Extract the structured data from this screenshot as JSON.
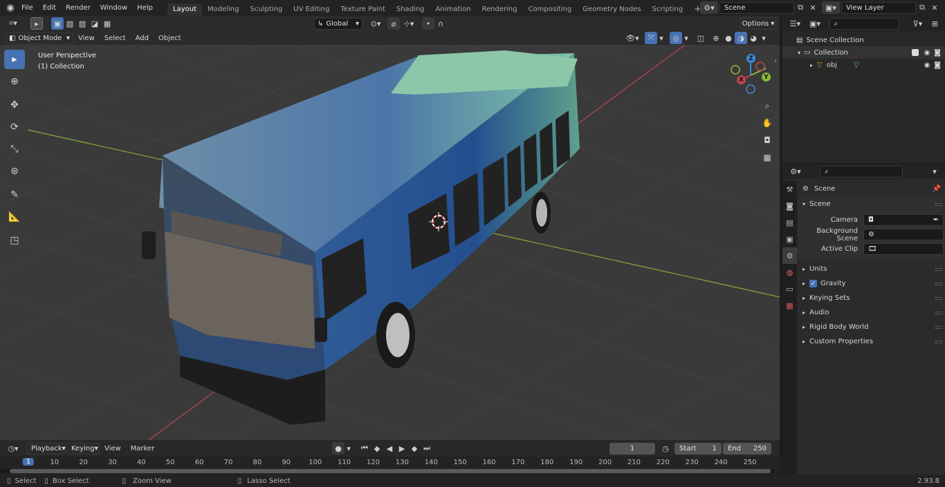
{
  "topbar": {
    "menus": [
      "File",
      "Edit",
      "Render",
      "Window",
      "Help"
    ],
    "workspaces": [
      "Layout",
      "Modeling",
      "Sculpting",
      "UV Editing",
      "Texture Paint",
      "Shading",
      "Animation",
      "Rendering",
      "Compositing",
      "Geometry Nodes",
      "Scripting"
    ],
    "add_tab": "+",
    "scene_value": "Scene",
    "view_layer_value": "View Layer"
  },
  "viewport_header": {
    "transform_orientation": "Global",
    "options_label": "Options",
    "mode": "Object Mode",
    "menus": [
      "View",
      "Select",
      "Add",
      "Object"
    ]
  },
  "viewport": {
    "overlay_line1": "User Perspective",
    "overlay_line2": "(1) Collection",
    "gizmo": {
      "z": "Z",
      "y": "Y",
      "x": "X"
    }
  },
  "outliner": {
    "scene_collection": "Scene Collection",
    "collection": "Collection",
    "object": "obj"
  },
  "properties": {
    "context_label": "Scene",
    "panel_title": "Scene",
    "fields": [
      {
        "label": "Camera",
        "value": ""
      },
      {
        "label": "Background Scene",
        "value": ""
      },
      {
        "label": "Active Clip",
        "value": ""
      }
    ],
    "subpanels": [
      "Units",
      "Gravity",
      "Keying Sets",
      "Audio",
      "Rigid Body World",
      "Custom Properties"
    ],
    "gravity_checked": true
  },
  "timeline": {
    "menus": [
      "Playback",
      "Keying",
      "View",
      "Marker"
    ],
    "current_frame": "1",
    "start_label": "Start",
    "start_value": "1",
    "end_label": "End",
    "end_value": "250",
    "ticks": [
      "1",
      "10",
      "20",
      "30",
      "40",
      "50",
      "60",
      "70",
      "80",
      "90",
      "100",
      "110",
      "120",
      "130",
      "140",
      "150",
      "160",
      "170",
      "180",
      "190",
      "200",
      "210",
      "220",
      "230",
      "240",
      "250"
    ]
  },
  "statusbar": {
    "items": [
      "Select",
      "Box Select",
      "Zoom View",
      "Lasso Select"
    ],
    "version": "2.93.8"
  },
  "colors": {
    "accent": "#4772b3",
    "x_axis": "#c0454f",
    "y_axis": "#8cb838",
    "z_axis": "#3b8bd8"
  }
}
